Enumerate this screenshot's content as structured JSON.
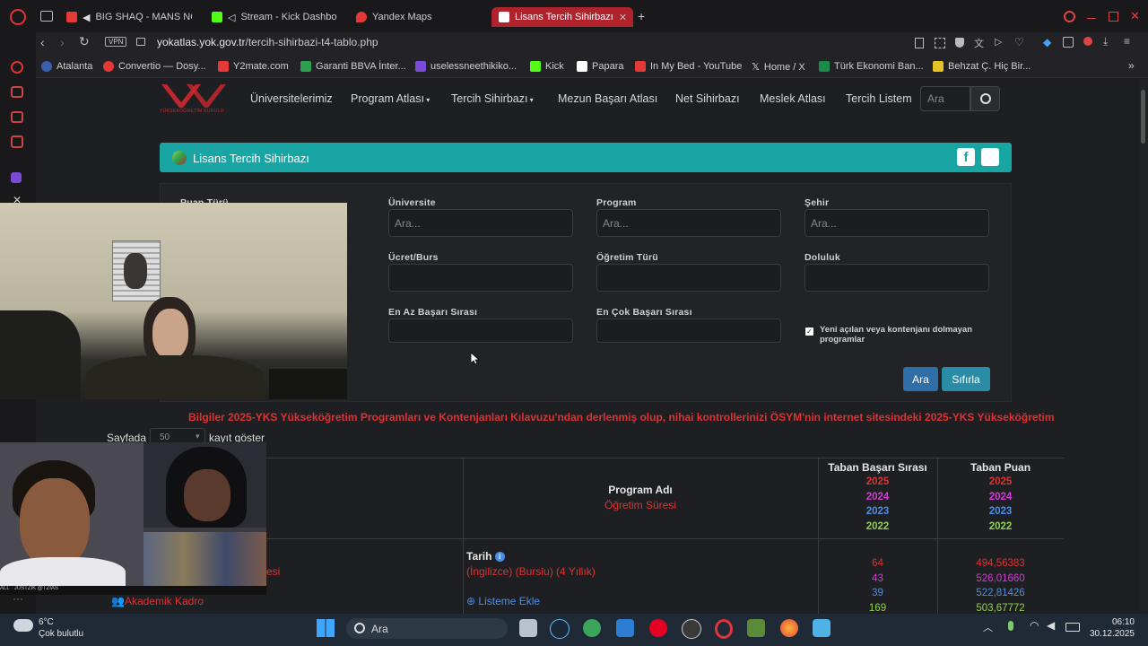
{
  "browser": {
    "tabs": [
      {
        "label": "BIG SHAQ - MANS NO",
        "icon": "youtube-icon"
      },
      {
        "label": "Stream - Kick Dashbo",
        "icon": "kick-icon"
      },
      {
        "label": "Yandex Maps",
        "icon": "map-pin-icon"
      },
      {
        "label": "Lisans Tercih Sihirbazı",
        "icon": "yok-icon",
        "active": true
      }
    ],
    "new_tab": "+",
    "vpn_badge": "VPN",
    "url_host": "yokatlas.yok.gov.tr",
    "url_path": "/tercih-sihirbazi-t4-tablo.php",
    "bookmarks": [
      "Atalanta",
      "Convertio — Dosy...",
      "Y2mate.com",
      "Garanti BBVA İnter...",
      "uselessneethikiko...",
      "Kick",
      "Papara",
      "In My Bed - YouTube",
      "Home / X",
      "Türk Ekonomi Ban...",
      "Behzat Ç. Hiç Bir..."
    ]
  },
  "site": {
    "logo_caption": "YÜKSEKÖĞRETİM KURULU",
    "nav": [
      "Üniversitelerimiz",
      "Program Atlası",
      "Tercih Sihirbazı",
      "Mezun Başarı Atlası",
      "Net Sihirbazı",
      "Meslek Atlası",
      "Tercih Listem"
    ],
    "search_placeholder": "Ara"
  },
  "panel": {
    "title": "Lisans Tercih Sihirbazı",
    "fields": {
      "puan_turu": "Puan Türü",
      "universite": "Üniversite",
      "program": "Program",
      "sehir": "Şehir",
      "ucret": "Ücret/Burs",
      "ogretim": "Öğretim Türü",
      "doluluk": "Doluluk",
      "en_az": "En Az Başarı Sırası",
      "en_cok": "En Çok Başarı Sırası"
    },
    "placeholder": "Ara...",
    "checkbox_label": "Yeni açılan veya kontenjanı dolmayan programlar",
    "search_button": "Ara",
    "reset_button": "Sıfırla"
  },
  "notice": "Bilgiler 2025-YKS Yükseköğretim Programları ve Kontenjanları Kılavuzu'ndan derlenmiş olup, nihai kontrollerinizi ÖSYM'nin internet sitesindeki 2025-YKS Yükseköğretim",
  "length_control": {
    "prefix": "Sayfada",
    "value": "50",
    "suffix": "kayıt göster"
  },
  "table": {
    "col_program": "Program Adı",
    "col_program_sub": "Öğretim Süresi",
    "col_rank": "Taban Başarı Sırası",
    "col_score": "Taban Puan",
    "years": [
      "2025",
      "2024",
      "2023",
      "2022"
    ],
    "year_colors": [
      "#e03131",
      "#d63ad6",
      "#4c8ee6",
      "#8fd14f"
    ],
    "row": {
      "uni_suffix": "esi",
      "akademik": "Akademik Kadro",
      "program": "Tarih",
      "detail": "(İngilizce) (Burslu) (4 Yıllık)",
      "add": "Listeme Ekle",
      "ranks": [
        "64",
        "43",
        "39",
        "169"
      ],
      "scores": [
        "494,56383",
        "526,01660",
        "522,81426",
        "503,67772"
      ]
    }
  },
  "taskbar": {
    "weather_temp": "6°C",
    "weather_desc": "Çok bulutlu",
    "search": "Ara",
    "time": "06:10",
    "date": "30.12.2025"
  },
  "overlay": {
    "cam2_caption": "ALL · JUSTZIK @TZIAS"
  }
}
